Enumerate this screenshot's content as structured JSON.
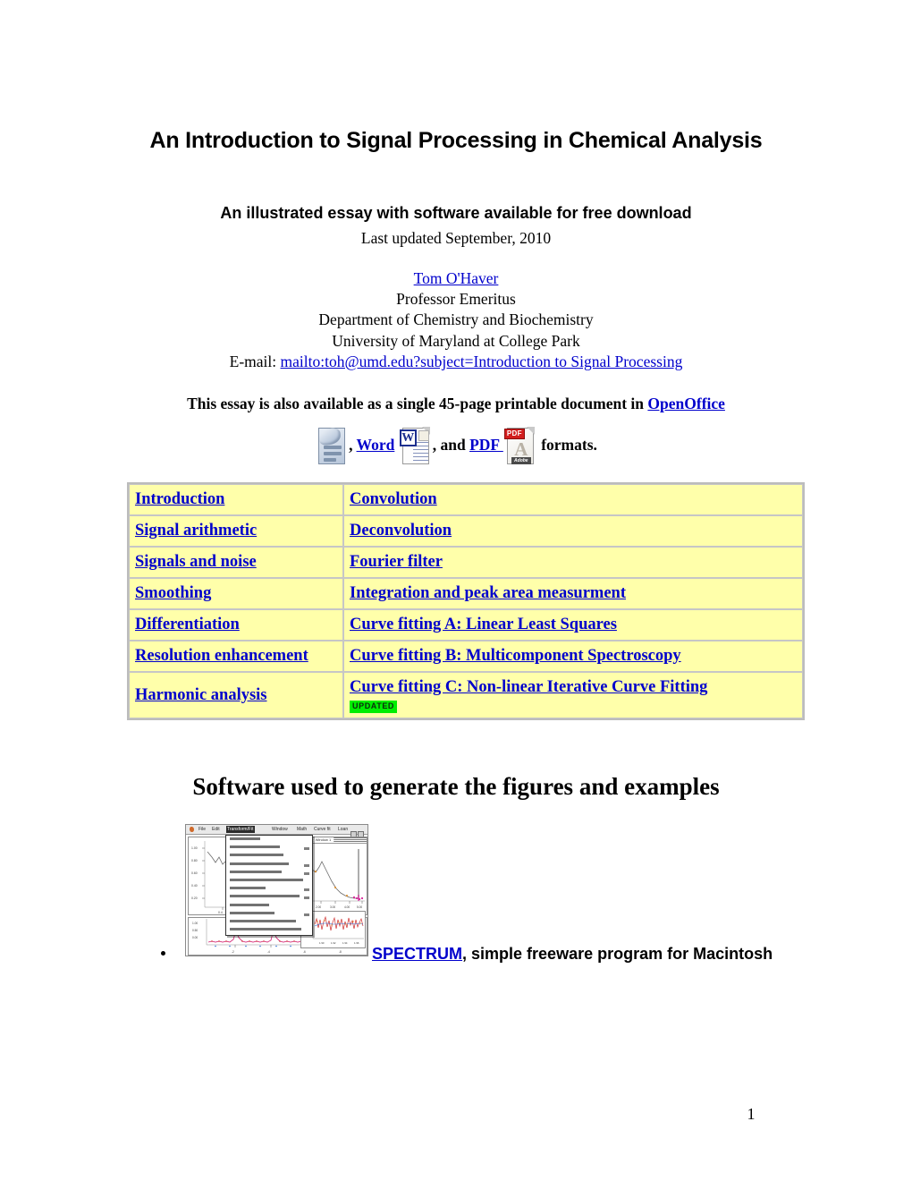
{
  "document": {
    "title_main": "An Introduction to Signal Processing in Chemical Analysis",
    "subtitle": "An illustrated essay with software available for free download",
    "last_updated": "Last updated September, 2010"
  },
  "author": {
    "name": "Tom O'Haver ",
    "role": "Professor Emeritus",
    "department": "Department of Chemistry and Biochemistry",
    "institution": "University of Maryland at College Park",
    "email_label": "E-mail: ",
    "email_link": "mailto:toh@umd.edu?subject=Introduction to Signal Processing"
  },
  "formats": {
    "lead_text": "This essay is also available as a single 45-page printable document in ",
    "openoffice_label": "OpenOffice",
    "sep1": ", ",
    "word_label": "Word",
    "sep2": ", and ",
    "pdf_label": "PDF ",
    "tail_text": " formats.",
    "icons": {
      "openoffice": "openoffice-document-icon",
      "word": "word-document-icon",
      "pdf": "pdf-document-icon",
      "word_badge": "W",
      "pdf_badge": "PDF",
      "pdf_acrobat": "A",
      "pdf_adobe": "Adobe"
    }
  },
  "toc": {
    "rows": [
      {
        "left": "Introduction",
        "right": "Convolution"
      },
      {
        "left": "Signal arithmetic",
        "right": "Deconvolution"
      },
      {
        "left": "Signals and noise",
        "right": "Fourier filter"
      },
      {
        "left": "Smoothing",
        "right": "Integration and peak area measurment"
      },
      {
        "left": "Differentiation",
        "right": "Curve fitting A: Linear Least Squares"
      },
      {
        "left": "Resolution enhancement",
        "right": "Curve fitting B: Multicomponent Spectroscopy"
      },
      {
        "left": "Harmonic analysis",
        "right": "Curve fitting C: Non-linear Iterative Curve Fitting"
      }
    ],
    "updated_badge": "UPDATED",
    "background_color": "#ffffaa",
    "border_color": "#c6c6c6",
    "link_color": "#0000cc"
  },
  "software_section": {
    "heading": "Software used to generate the figures and examples",
    "screenshot": {
      "name": "spectrum-program-screenshot",
      "menus": [
        "File",
        "Edit",
        "Transform/Fit",
        "Window",
        "Math",
        "Curve fit",
        "Loan"
      ],
      "active_menu": "Transform/Fit",
      "window_title": "Window 1"
    },
    "bullet": {
      "link_label": "SPECTRUM",
      "text": ", simple freeware program for Macintosh"
    }
  },
  "footer": {
    "page_number": "1"
  }
}
